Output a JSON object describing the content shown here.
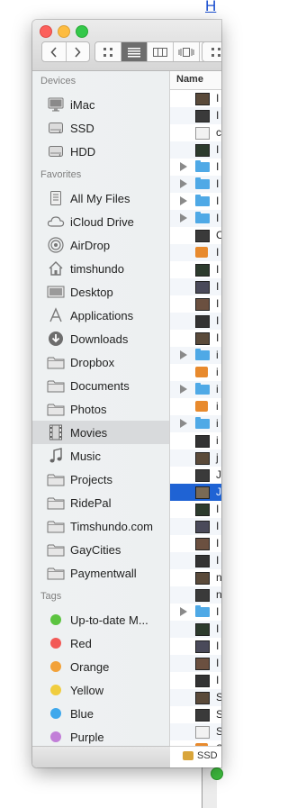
{
  "background_link": "H",
  "column_header": "Name",
  "sidebar": {
    "sections": [
      {
        "title": "Devices",
        "items": [
          {
            "label": "iMac",
            "icon": "imac-icon"
          },
          {
            "label": "SSD",
            "icon": "drive-icon"
          },
          {
            "label": "HDD",
            "icon": "drive-icon"
          }
        ]
      },
      {
        "title": "Favorites",
        "items": [
          {
            "label": "All My Files",
            "icon": "all-files-icon"
          },
          {
            "label": "iCloud Drive",
            "icon": "cloud-icon"
          },
          {
            "label": "AirDrop",
            "icon": "airdrop-icon"
          },
          {
            "label": "timshundo",
            "icon": "home-icon"
          },
          {
            "label": "Desktop",
            "icon": "desktop-icon"
          },
          {
            "label": "Applications",
            "icon": "applications-icon"
          },
          {
            "label": "Downloads",
            "icon": "downloads-icon"
          },
          {
            "label": "Dropbox",
            "icon": "folder-icon"
          },
          {
            "label": "Documents",
            "icon": "folder-icon"
          },
          {
            "label": "Photos",
            "icon": "folder-icon"
          },
          {
            "label": "Movies",
            "icon": "film-icon",
            "selected": true
          },
          {
            "label": "Music",
            "icon": "music-icon"
          },
          {
            "label": "Projects",
            "icon": "folder-icon"
          },
          {
            "label": "RidePal",
            "icon": "folder-icon"
          },
          {
            "label": "Timshundo.com",
            "icon": "folder-icon"
          },
          {
            "label": "GayCities",
            "icon": "folder-icon"
          },
          {
            "label": "Paymentwall",
            "icon": "folder-icon"
          }
        ]
      },
      {
        "title": "Tags",
        "items": [
          {
            "label": "Up-to-date M...",
            "color": "#5cc440"
          },
          {
            "label": "Red",
            "color": "#f25a57"
          },
          {
            "label": "Orange",
            "color": "#f2a23a"
          },
          {
            "label": "Yellow",
            "color": "#f0cd3e"
          },
          {
            "label": "Blue",
            "color": "#3ea8ec"
          },
          {
            "label": "Purple",
            "color": "#c27fd8"
          }
        ]
      }
    ]
  },
  "files": [
    {
      "kind": "video",
      "text": "I"
    },
    {
      "kind": "video",
      "text": "I"
    },
    {
      "kind": "doc",
      "text": "c"
    },
    {
      "kind": "video",
      "text": "I"
    },
    {
      "kind": "folder",
      "disclosure": true,
      "text": "I"
    },
    {
      "kind": "folder",
      "disclosure": true,
      "text": "I"
    },
    {
      "kind": "folder",
      "disclosure": true,
      "text": "I"
    },
    {
      "kind": "folder",
      "disclosure": true,
      "text": "I"
    },
    {
      "kind": "video",
      "text": "C"
    },
    {
      "kind": "app",
      "text": "I"
    },
    {
      "kind": "video",
      "text": "I"
    },
    {
      "kind": "video",
      "text": "I"
    },
    {
      "kind": "video",
      "text": "I"
    },
    {
      "kind": "video",
      "text": "I"
    },
    {
      "kind": "video",
      "text": "I"
    },
    {
      "kind": "folder",
      "disclosure": true,
      "text": "i"
    },
    {
      "kind": "app",
      "text": "i"
    },
    {
      "kind": "folder",
      "disclosure": true,
      "text": "i"
    },
    {
      "kind": "app",
      "text": "i"
    },
    {
      "kind": "folder",
      "disclosure": true,
      "text": "i"
    },
    {
      "kind": "video",
      "text": "i"
    },
    {
      "kind": "video",
      "text": "j"
    },
    {
      "kind": "video",
      "text": "J"
    },
    {
      "kind": "video",
      "text": "J",
      "selected": true
    },
    {
      "kind": "video",
      "text": "I"
    },
    {
      "kind": "video",
      "text": "I"
    },
    {
      "kind": "video",
      "text": "I"
    },
    {
      "kind": "video",
      "text": "I"
    },
    {
      "kind": "video",
      "text": "n"
    },
    {
      "kind": "video",
      "text": "n"
    },
    {
      "kind": "folder",
      "disclosure": true,
      "text": "I"
    },
    {
      "kind": "video",
      "text": "I"
    },
    {
      "kind": "video",
      "text": "I"
    },
    {
      "kind": "video",
      "text": "I"
    },
    {
      "kind": "video",
      "text": "I"
    },
    {
      "kind": "video",
      "text": "S"
    },
    {
      "kind": "video",
      "text": "S"
    },
    {
      "kind": "doc",
      "text": "S"
    },
    {
      "kind": "app",
      "text": "S"
    }
  ],
  "pathbar": {
    "drive": "SSD"
  }
}
